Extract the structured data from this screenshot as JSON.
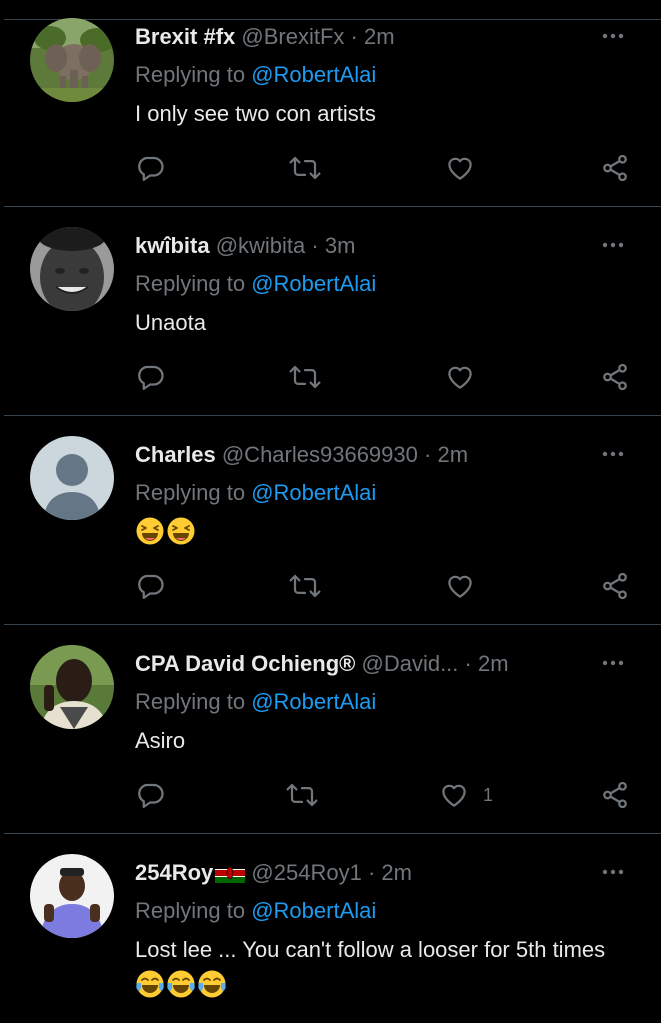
{
  "replying_prefix": "Replying to",
  "replies": [
    {
      "name": "Brexit #fx",
      "handle": "@BrexitFx",
      "separator": "·",
      "time": "2m",
      "mention": "@RobertAlai",
      "text": "I only see two con artists",
      "likes": ""
    },
    {
      "name": "kwîbita",
      "handle": "@kwibita",
      "separator": "·",
      "time": "3m",
      "mention": "@RobertAlai",
      "text": "Unaota",
      "likes": ""
    },
    {
      "name": "Charles",
      "handle": "@Charles93669930",
      "separator": "·",
      "time": "2m",
      "mention": "@RobertAlai",
      "text": "",
      "emoji": [
        "laughing-emoji",
        "laughing-emoji"
      ],
      "likes": ""
    },
    {
      "name": "CPA David Ochieng®",
      "handle": "@David...",
      "separator": "·",
      "time": "2m",
      "mention": "@RobertAlai",
      "text": "Asiro",
      "likes": "1"
    },
    {
      "name": "254Roy",
      "name_flag": "kenya-flag-icon",
      "handle": "@254Roy1",
      "separator": "·",
      "time": "2m",
      "mention": "@RobertAlai",
      "text": "Lost lee ... You can't follow a looser for 5th times",
      "emoji": [
        "tears-of-joy-emoji",
        "tears-of-joy-emoji",
        "tears-of-joy-emoji"
      ],
      "likes": ""
    }
  ],
  "icons": {
    "reply": "reply-icon",
    "retweet": "retweet-icon",
    "like": "heart-icon",
    "share": "share-icon",
    "more": "more-options-icon"
  },
  "colors": {
    "background": "#000000",
    "text": "#e7e9ea",
    "secondary": "#71767b",
    "link": "#1d9bf0",
    "divider": "#38444d"
  }
}
